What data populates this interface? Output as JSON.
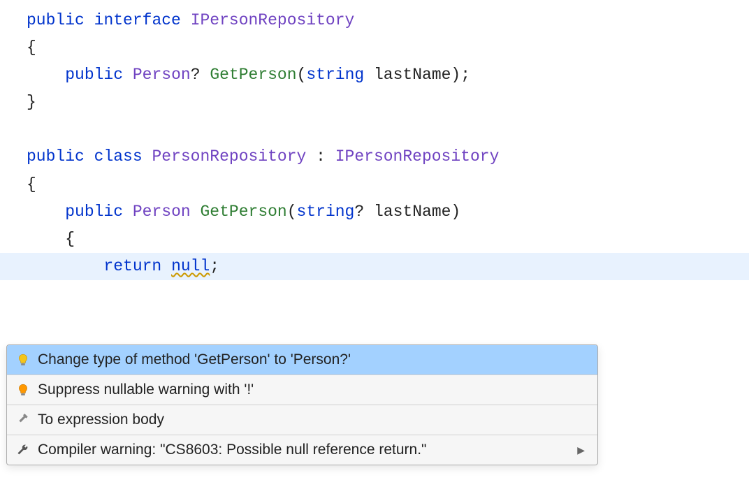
{
  "code": {
    "line1": {
      "kw1": "public",
      "kw2": "interface",
      "type": "IPersonRepository"
    },
    "line2": {
      "brace": "{"
    },
    "line3": {
      "kw": "public",
      "type": "Person",
      "q": "?",
      "method": "GetPerson",
      "open": "(",
      "paramType": "string",
      "paramName": "lastName",
      "close": ");"
    },
    "line4": {
      "brace": "}"
    },
    "line5": "",
    "line6": {
      "kw1": "public",
      "kw2": "class",
      "type1": "PersonRepository",
      "colon": " : ",
      "type2": "IPersonRepository"
    },
    "line7": {
      "brace": "{"
    },
    "line8": {
      "kw": "public",
      "type": "Person",
      "method": "GetPerson",
      "open": "(",
      "paramType": "string",
      "q": "?",
      "paramName": "lastName",
      "close": ")"
    },
    "line9": {
      "brace": "{"
    },
    "line10": {
      "kw": "return",
      "val": "null",
      "semi": ";"
    }
  },
  "popup": {
    "items": [
      {
        "label": "Change type of method 'GetPerson' to 'Person?'",
        "icon": "bulb-yellow",
        "selected": true,
        "hasArrow": false
      },
      {
        "label": "Suppress nullable warning with '!'",
        "icon": "bulb-orange",
        "selected": false,
        "hasArrow": false
      },
      {
        "label": "To expression body",
        "icon": "hammer",
        "selected": false,
        "hasArrow": false
      },
      {
        "label": "Compiler warning: \"CS8603: Possible null reference return.\"",
        "icon": "wrench",
        "selected": false,
        "hasArrow": true
      }
    ]
  },
  "colors": {
    "keyword": "#0033cc",
    "type": "#6f42c1",
    "method": "#2e7d32",
    "highlight": "#e8f2fe",
    "selection": "#a3d1ff",
    "squiggle": "#cc9900"
  }
}
